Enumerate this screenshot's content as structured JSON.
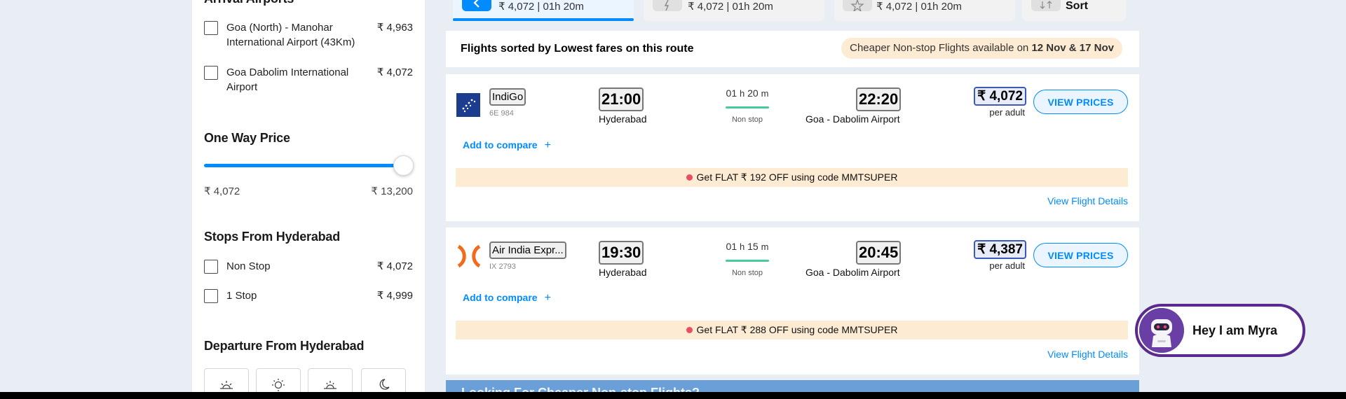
{
  "sidebar": {
    "arrival_heading": "Arrival Airports",
    "arrival_airports": [
      {
        "label": "Goa (North) - Manohar International Airport (43Km)",
        "price": "₹ 4,963"
      },
      {
        "label": "Goa Dabolim International Airport",
        "price": "₹ 4,072"
      }
    ],
    "price_heading": "One Way Price",
    "price_min": "₹ 4,072",
    "price_max": "₹ 13,200",
    "price_slider_fraction": 1.0,
    "stops_heading": "Stops From Hyderabad",
    "stops": [
      {
        "label": "Non Stop",
        "price": "₹ 4,072"
      },
      {
        "label": "1 Stop",
        "price": "₹ 4,999"
      }
    ],
    "departure_heading": "Departure From Hyderabad",
    "departure_icons": [
      "sunrise-icon",
      "sun-icon",
      "sunset-icon",
      "moon-icon"
    ]
  },
  "tabs": [
    {
      "text": "₹ 4,072 | 01h 20m",
      "icon": "rupee-icon",
      "active": true
    },
    {
      "text": "₹ 4,072 | 01h 20m",
      "icon": "lightning-icon",
      "active": false
    },
    {
      "text": "₹ 4,072 | 01h 20m",
      "icon": "star-icon",
      "active": false
    },
    {
      "text": "Sort",
      "icon": "sort-icon",
      "active": false
    }
  ],
  "sorted": {
    "title": "Flights sorted by Lowest fares on this route",
    "nonstop_prefix": "Cheaper Non-stop Flights available on ",
    "nonstop_dates": "12 Nov & 17 Nov"
  },
  "flights": [
    {
      "airline": "IndiGo",
      "flight_no": "6E 984",
      "dep_time": "21:00",
      "dep_city": "Hyderabad",
      "dur_h": "01",
      "dur_m": "20",
      "h_unit": "h",
      "m_unit": "m",
      "stops": "Non stop",
      "arr_time": "22:20",
      "arr_city": "Goa - Dabolim Airport",
      "price": "₹ 4,072",
      "per_adult": "per adult",
      "button": "VIEW PRICES",
      "compare": "Add to compare",
      "compare_plus": "+",
      "offer": "Get FLAT ₹ 192 OFF using code MMTSUPER",
      "details": "View Flight Details"
    },
    {
      "airline": "Air India Expr...",
      "flight_no": "IX 2793",
      "dep_time": "19:30",
      "dep_city": "Hyderabad",
      "dur_h": "01",
      "dur_m": "15",
      "h_unit": "h",
      "m_unit": "m",
      "stops": "Non stop",
      "arr_time": "20:45",
      "arr_city": "Goa - Dabolim Airport",
      "price": "₹ 4,387",
      "per_adult": "per adult",
      "button": "VIEW PRICES",
      "compare": "Add to compare",
      "compare_plus": "+",
      "offer": "Get FLAT ₹ 288 OFF using code MMTSUPER",
      "details": "View Flight Details"
    }
  ],
  "banner": {
    "text": "Looking For Cheaper Non-stop Flights?"
  },
  "chatbot": {
    "label": "Hey I am Myra"
  },
  "colors": {
    "accent": "#008cff",
    "offer_bg": "#fdecd3",
    "duration_line": "#47c9a2",
    "myra_border": "#5a2a8c"
  }
}
